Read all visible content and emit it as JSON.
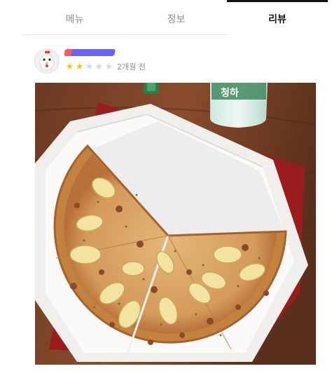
{
  "tabs": [
    {
      "label": "메뉴"
    },
    {
      "label": "정보"
    },
    {
      "label": "리뷰"
    }
  ],
  "review": {
    "author_name": "",
    "rating": 2,
    "rating_max": 5,
    "time_ago": "2개월 전",
    "bottle_label": "청하",
    "avatar_icon": "chicken-avatar-icon",
    "star_icon": "star-icon"
  },
  "colors": {
    "active_tab": "#111111",
    "inactive_tab": "#8c8c8c",
    "star_on": "#f5c518",
    "star_off": "#d8d8d8",
    "redacted_name": "#6b61ff"
  }
}
